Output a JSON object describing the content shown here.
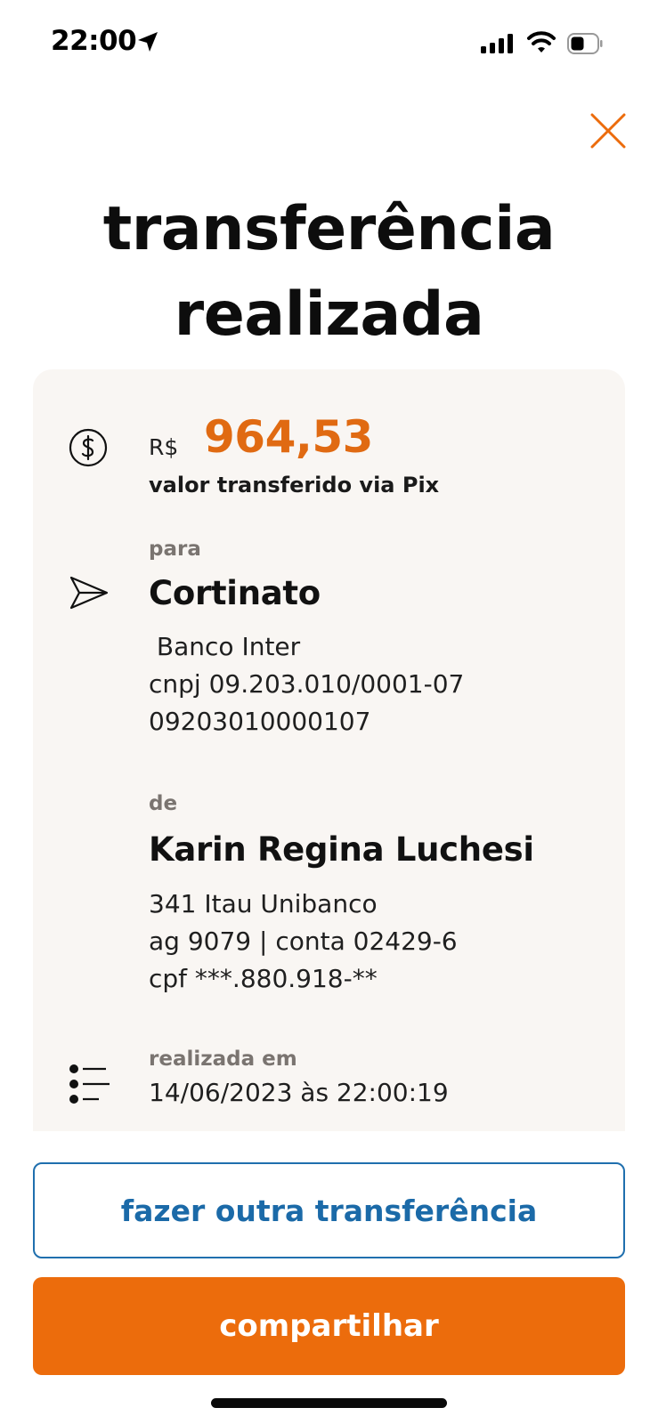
{
  "status_bar": {
    "time": "22:00",
    "icons": [
      "location-arrow-icon",
      "cellular-signal-icon",
      "wifi-icon",
      "battery-icon"
    ]
  },
  "header": {
    "close_icon": "close-icon"
  },
  "title": {
    "line1": "transferência",
    "line2": "realizada"
  },
  "receipt": {
    "amount_icon": "dollar-circle-icon",
    "currency": "R$",
    "amount": "964,53",
    "amount_caption": "valor transferido via Pix",
    "recipient": {
      "icon": "send-icon",
      "label": "para",
      "name": "Cortinato",
      "bank": " Banco Inter",
      "document": "cnpj 09.203.010/0001-07",
      "key": "09203010000107"
    },
    "sender": {
      "label": "de",
      "name": "Karin Regina Luchesi",
      "bank": "341 Itau Unibanco",
      "account": "ag 9079 | conta 02429-6",
      "document": "cpf ***.880.918-**"
    },
    "date": {
      "icon": "list-icon",
      "label": "realizada em",
      "value": "14/06/2023 às 22:00:19"
    }
  },
  "actions": {
    "secondary_label": "fazer outra transferência",
    "primary_label": "compartilhar"
  },
  "colors": {
    "accent_orange": "#ec6c0c",
    "amount_orange": "#e06a12",
    "link_blue": "#1b6aa8",
    "card_background": "#f9f6f3"
  }
}
